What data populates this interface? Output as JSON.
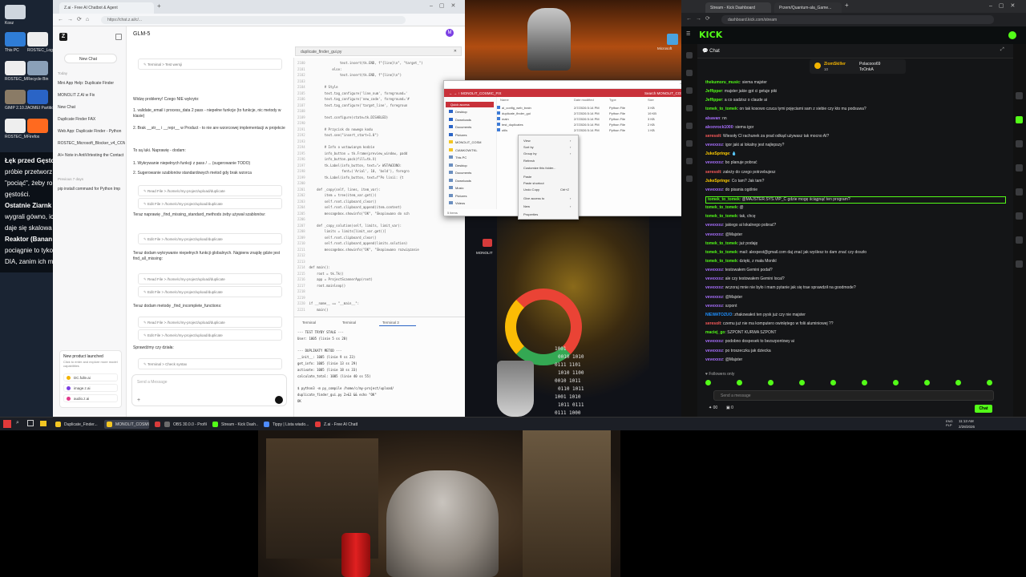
{
  "desktop": {
    "icons": [
      {
        "label": "Kosz",
        "color": "#cfd6de"
      },
      {
        "label": "This PC",
        "color": "#2f7dd6"
      },
      {
        "label": "ROSTEC_Log",
        "color": "#eeeeee"
      },
      {
        "label": "ROSTEC_M",
        "color": "#eeeeee"
      },
      {
        "label": "Recycle Bin",
        "color": "#8aa0b8"
      },
      {
        "label": "GIMP 2.10.2",
        "color": "#8a7b66"
      },
      {
        "label": "AOMEI Partition",
        "color": "#2a64c6"
      },
      {
        "label": "ROSTEC_M",
        "color": "#eeeeee"
      },
      {
        "label": "Firefox",
        "color": "#ff6a1f"
      },
      {
        "label": "Microsoft Edge",
        "color": "#1d9fd8"
      }
    ],
    "overlay_lines": [
      "Łęk przed Gęsto",
      "próbie przetworz",
      "\"pociąć\", żeby ro",
      "gęstości.",
      "Ostatnie Ziarnk",
      "wygrali gówno, ic",
      "daje się skalowa",
      "Reaktor (Banan",
      "pociągnie to tyko",
      "DIA, zanim ich ma"
    ]
  },
  "browser_left": {
    "tabs": [
      "Z.ai - Free AI Chatbot & Agent"
    ],
    "url": "https://chat.z.ai/c/..."
  },
  "zai": {
    "model_label": "GLM-5",
    "new_chat": "New Chat",
    "section_today": "Today",
    "history_today": [
      "Mini App Help: Duplicate Finder",
      "MONOLIT Z.AI w Fix",
      "New Chat",
      "Duplicate Finder FAX",
      "Web App: Duplicate Finder - Python",
      "ROSTEC_Microsoft_Blocker_v4_COM",
      "AI+ Note in AntiVirtesting the Contact"
    ],
    "section_previous": "Previous 7 days",
    "history_previous": [
      "pip install command for Python Imp"
    ],
    "promo_title": "New product launched",
    "promo_sub": "Click to enter and explore more model capabilities",
    "promo_items": [
      "DC.fulle.ai",
      "image.z.ai",
      "audio.z.ai"
    ],
    "messages": [
      "Widzę problemy! Czego NIE wykryto:",
      "1. validate_email i process_data 2 pass - niepełne funkcje (to funkcje, nic metody w klasie)",
      "2. Brak __str__ i __repr__ w Product - to nie are wzorcowej implementacji w projekcie",
      "To są luki. Naprawię - dodam:",
      "1. Wykrywanie niepełnych funkcji z pass / ... (sugerowanie TODO)",
      "2. Sugerowanie szablonów standardowych metod gdy brak wzorca",
      "Teraz naprawię _find_missing_standard_methods żeby używał szablonów:",
      "Teraz dodam wykrywanie niepełnych funkcji globalnych. Najpierw znajdę gdzie jest find_all_missing:",
      "Teraz dodam metodę _find_incomplete_functions:",
      "Sprawdźmy czy działa:"
    ],
    "tool_calls": [
      "Terminal > Test wersji",
      "Read File > /home/c/my-project/upload/duplicate",
      "Edit File > /home/c/my-project/upload/duplicate",
      "Edit File > /home/c/my-project/upload/duplicate",
      "Read File > /home/c/my-project/upload/duplicate",
      "Edit File > /home/c/my-project/upload/duplicate",
      "Read File > /home/c/my-project/upload/duplicate",
      "Edit File > /home/c/my-project/upload/duplicate",
      "Terminal > Check syntax"
    ],
    "input_placeholder": "Send a Message"
  },
  "editor": {
    "filename": "duplicate_finder_gui.py",
    "code": [
      "                text.insert(tk.END, f\"{line}\\n\", \"target_\")",
      "            else:",
      "                text.insert(tk.END, f\"{line}\\n\")",
      "",
      "        # Style",
      "        text.tag_configure('line_num', foreground='",
      "        text.tag_configure('new_code', foreground='#",
      "        text.tag_configure('target_line', foregroun",
      "",
      "        text.configure(state=tk.DISABLED)",
      "",
      "        # Przycisk do nowego kodu",
      "        text.see(\"insert_start+1.0\")",
      "",
      "        # Info o wstawianym kodzie",
      "        info_button = tk.Frame(preview_window, padd",
      "        info_button.pack(fill=tk.X)",
      "        tk.Label(info_button, text=\"✔ WSTAWIONO:",
      "                 font=('Arial', 10, 'bold'), foregro",
      "        tk.Label(info_button, text=f\"Po linii: {t",
      "",
      "    def _copy(self, lines, item_var):",
      "        item = tree(item_var.get())",
      "        self.root.clipboard_clear()",
      "        self.root.clipboard_append(item.content)",
      "        messagebox.showinfo(\"OK\", \"Skopiowano do sch",
      "",
      "    def _copy_solution(self, limits, limit_var):",
      "        limits = limits[limit_var.get()]",
      "        self.root.clipboard_clear()",
      "        self.root.clipboard_append(limits.solution)",
      "        messagebox.showinfo(\"OK\", \"Skopiowano rozwiązanie",
      "",
      "",
      "def main():",
      "    root = tk.Tk()",
      "    app = ProjectScannerApp(root)",
      "    root.mainloop()",
      "",
      "",
      "if __name__ == \"__main__\":",
      "    main()"
    ],
    "line_start": 2180
  },
  "terminal": {
    "tabs": [
      "Terminal",
      "Terminal",
      "Terminal 3"
    ],
    "lines": [
      "--- TEST TRYBY STAŁE ---",
      "User: 1005 (linie 5 ss 28)",
      "",
      "--- DUPLIKATY METOD ---",
      "__init__: 1005 (linie 9 ss 23)",
      "get_info: 1005 (linie 13 ss 29)",
      "activate: 1005 (linie 18 ss 33)",
      "calculate_total: 1005 (linie 40 ss 55)",
      "",
      "$ python3 -m py_compile /home/c/my-project/upload/",
      "duplicate_finder_gui.py 2>&1 && echo \"OK\"",
      "OK"
    ]
  },
  "explorer": {
    "title": "MONOLIT_COSMIC_FIX",
    "search": "Search MONOLIT_COSMIC_FI...",
    "quick_access": "Quick access",
    "nav": [
      "Desktop",
      "Downloads",
      "Documents",
      "Pictures",
      "MONOLIT_COSM",
      "CIANKOW/TKL",
      "This PC",
      "Desktop",
      "Documents",
      "Downloads",
      "Music",
      "Pictures",
      "Videos"
    ],
    "columns": [
      "Name",
      "Date modified",
      "Type",
      "Size"
    ],
    "files": [
      {
        "name": "ai_config_web_brain",
        "date": "2/7/2026 5:14 PM",
        "type": "Python File",
        "size": "3 KB"
      },
      {
        "name": "duplicate_finder_gui",
        "date": "2/7/2026 5:14 PM",
        "type": "Python File",
        "size": "19 KB"
      },
      {
        "name": "main",
        "date": "2/7/2026 5:14 PM",
        "type": "Python File",
        "size": "3 KB"
      },
      {
        "name": "test_duplicates",
        "date": "2/7/2026 5:14 PM",
        "type": "Python File",
        "size": "2 KB"
      },
      {
        "name": "utils",
        "date": "2/7/2026 5:14 PM",
        "type": "Python File",
        "size": "1 KB"
      }
    ],
    "status": "5 items"
  },
  "context_menu": [
    "View",
    "Sort by",
    "Group by",
    "Refresh",
    "Customize this folder...",
    "Paste",
    "Paste shortcut",
    "Undo Copy",
    "Give access to",
    "New",
    "Properties"
  ],
  "context_menu_shortcut": "Ctrl+Z",
  "wallpaper": {
    "desktop_icon_label": "Microsoft",
    "apple_label": "MONOLIT",
    "google_letter": "G",
    "binary": [
      "1001",
      "0010 1010",
      "0111 1101",
      "1010 1100",
      "0010 1011",
      "0110 1011",
      "1001 1010",
      "1011 0111",
      "0111 1000"
    ]
  },
  "kick": {
    "tabs": [
      "Stream - Kick Dashboard",
      "Przem/Quantum-ala_Game...",
      "+"
    ],
    "url": "dashboard.kick.com/stream",
    "logo": "KICK",
    "chat_label": "Chat",
    "pinned": {
      "user": "ZiomSkiller",
      "badge": "Polacooo69",
      "count": "10",
      "user2": "ToOnkA"
    },
    "messages": [
      {
        "user": "thekumoru_music",
        "text": "siema majster",
        "color": "#53fc18"
      },
      {
        "user": "Jeffipper",
        "text": "majster jakie gpt ci getuje piki",
        "color": "#53fc18"
      },
      {
        "user": "Jeffipper",
        "text": "a co sadzisz o claude ai",
        "color": "#53fc18"
      },
      {
        "user": "tomek_to_tomek",
        "text": "on tak kosowo czuca tymi pojęciami sam z siebie czy kto mu podsuwa?",
        "color": "#53fc18"
      },
      {
        "user": "alsavan",
        "text": "nn",
        "color": "#a970ff"
      },
      {
        "user": "alexnrock1000",
        "text": "siema igor",
        "color": "#a970ff"
      },
      {
        "user": "seresolt",
        "text": "Wiesoły Cl rachunek za prad odkąd używasz tak mocno AI?",
        "color": "#ff5c5c"
      },
      {
        "user": "vevexxxz",
        "text": "igor jaki ai lokalny jest najlepszy?",
        "color": "#a970ff"
      },
      {
        "user": "JukeSpringe",
        "text": "💧",
        "color": "#ffcc00"
      },
      {
        "user": "vevexxxz",
        "text": "bo planuje pobrać",
        "color": "#a970ff"
      },
      {
        "user": "seresolt",
        "text": "zależy do czego potrzebujesz",
        "color": "#ff5c5c"
      },
      {
        "user": "JukeSpringe",
        "text": "Co tam? Jak tam?",
        "color": "#ffcc00"
      },
      {
        "user": "vevexxxz",
        "text": "do pisania ogólnie",
        "color": "#a970ff"
      },
      {
        "user": "tomek_to_tomek",
        "text": "@MAJSTER.SYS.VIP_C gdzie mogę ściągnąć ten program?",
        "color": "#53fc18"
      },
      {
        "user": "tomek_to_tomek",
        "text": "@",
        "color": "#53fc18"
      },
      {
        "user": "tomek_to_tomek",
        "text": "tak, chcę",
        "color": "#53fc18"
      },
      {
        "user": "vevexxxz",
        "text": "jakiego ai lokalnego pobrać?",
        "color": "#a970ff"
      },
      {
        "user": "vevexxxz",
        "text": "@Majster",
        "color": "#a970ff"
      },
      {
        "user": "tomek_to_tomek",
        "text": "już podaję",
        "color": "#53fc18"
      },
      {
        "user": "tomek_to_tomek",
        "text": "mail: alexpest@gmail.com daj znać jak wyślesz to dam znać czy doszło",
        "color": "#53fc18"
      },
      {
        "user": "tomek_to_tomek",
        "text": "dzięki, z mała Monikl",
        "color": "#53fc18"
      },
      {
        "user": "vevexxxz",
        "text": "testowałem Gemini podał?",
        "color": "#a970ff"
      },
      {
        "user": "vevexxxz",
        "text": "ale czy testowałem Gemini local?",
        "color": "#a970ff"
      },
      {
        "user": "vevexxxz",
        "text": "wczoraj mnie nie było i mam pytanie jak się trae sprawdził na goodmode?",
        "color": "#a970ff"
      },
      {
        "user": "vevexxxz",
        "text": "@Majster",
        "color": "#a970ff"
      },
      {
        "user": "vevexxxz",
        "text": "szpont",
        "color": "#a970ff"
      },
      {
        "user": "NIEWATOZUO",
        "text": "zhakowałeś ten pysk już czy nie majster",
        "color": "#1e90ff"
      },
      {
        "user": "seresolt",
        "text": "czemu już nie ma komputero owinlętego w folii aluminiowej ??",
        "color": "#ff5c5c"
      },
      {
        "user": "maciej_go",
        "text": "SZPONT KURWA SZPONT",
        "color": "#53fc18"
      },
      {
        "user": "vevexxxz",
        "text": "podobno dospesek to bezszpontowy ai",
        "color": "#a970ff"
      },
      {
        "user": "vevexxxz",
        "text": "po troszeczku jak dziecka",
        "color": "#a970ff"
      },
      {
        "user": "vevexxxz",
        "text": "@Majster",
        "color": "#a970ff"
      }
    ],
    "followers_only": "Followers only",
    "input_placeholder": "Send a message",
    "send_label": "Chat",
    "counter_a": "00",
    "counter_b": "0"
  },
  "taskbar": {
    "items": [
      {
        "label": "Duplicate_Finder...",
        "color": "#f3c623"
      },
      {
        "label": "MONOLIT_COSMI...",
        "color": "#f3c623"
      },
      {
        "label": "",
        "color": "#d83b3b"
      },
      {
        "label": "OBS 30.0.0 - Profile...",
        "color": "#6b6b6b"
      },
      {
        "label": "Stream - Kick Dash...",
        "color": "#53fc18"
      },
      {
        "label": "Tippy | Lista wiado...",
        "color": "#4e8cff"
      },
      {
        "label": "Z.ai - Free AI Chatb...",
        "color": "#e23a3a"
      }
    ],
    "lang": "ENG\nPLP",
    "time": "11:13 AM",
    "date": "2/28/2026"
  },
  "colors": {
    "kick_green": "#53fc18",
    "accent_red": "#d62b2b",
    "zai_purple": "#7b3fe4"
  }
}
